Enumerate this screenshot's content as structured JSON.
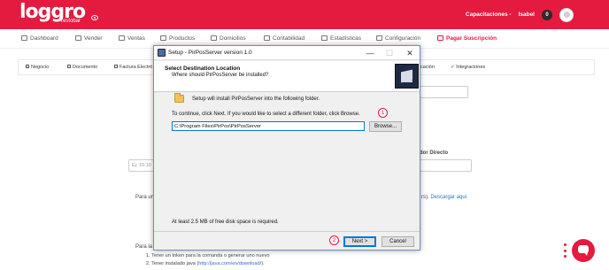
{
  "app": {
    "logo_text": "loggro",
    "logo_sub": "restobar",
    "capacitaciones": "Capacitaciones -",
    "user_name": "Isabel",
    "notif_count": "0",
    "brand_color": "#e41a3f"
  },
  "nav": {
    "items": [
      {
        "label": "Dashboard",
        "icon": "dashboard-icon"
      },
      {
        "label": "Vender",
        "icon": "cart-icon"
      },
      {
        "label": "Ventas",
        "icon": "tag-icon"
      },
      {
        "label": "Productos",
        "icon": "box-icon"
      },
      {
        "label": "Domicilios",
        "icon": "bike-icon"
      },
      {
        "label": "Contabilidad",
        "icon": "bank-icon"
      },
      {
        "label": "Estadísticas",
        "icon": "chart-icon"
      },
      {
        "label": "Configuración",
        "icon": "gear-icon"
      }
    ],
    "subscribe_label": "Pagar Suscripción"
  },
  "subtabs": {
    "negocio": "Negocio",
    "documento": "Documento",
    "factura": "Factura Electró",
    "cacion": "cación",
    "integraciones": "Integraciones"
  },
  "background": {
    "field_placeholder": "Ej: 10.10",
    "lector_label": "dor Directo",
    "para_un": "Para un",
    "descargar_prefix": "rs).",
    "descargar_link": "Descargar aqui",
    "para_la": "Para la",
    "step1": "1. Tener un token para la comanda o generar uno nuevo",
    "step2_prefix": "2. Tener instalado java (",
    "step2_link": "http://java.com/es/download/",
    "step2_suffix": ")."
  },
  "dialog": {
    "title": "Setup - PirPosServer version 1.0",
    "heading": "Select Destination Location",
    "subheading": "Where should PirPosServer be installed?",
    "intro": "Setup will install PirPosServer into the following folder.",
    "instruction": "To continue, click Next. If you would like to select a different folder, click Browse.",
    "path_value": "C:\\Program Files\\PirPos\\PirPosServer",
    "browse_label": "Browse...",
    "disk_space": "At least 2.5 MB of free disk space is required.",
    "next_label": "Next >",
    "cancel_label": "Cancel",
    "minimize_glyph": "—",
    "maximize_glyph": "☐",
    "close_glyph": "✕"
  },
  "annotations": {
    "one": "1",
    "two": "2"
  }
}
